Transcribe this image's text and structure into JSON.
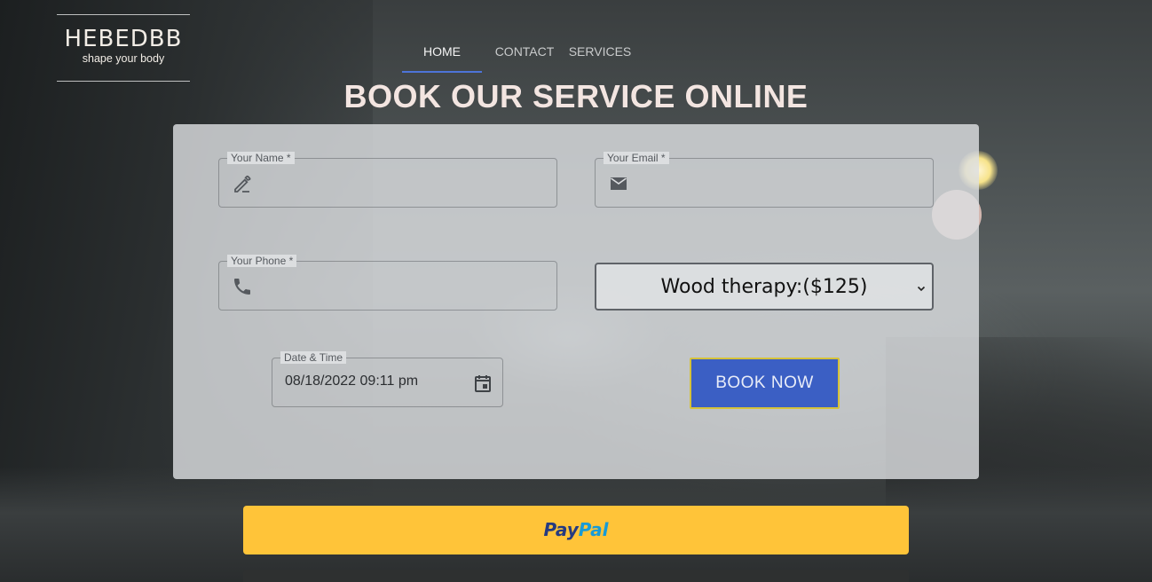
{
  "brand": {
    "name": "HEBEDBB",
    "tagline": "shape your body"
  },
  "nav": {
    "items": [
      {
        "label": "HOME",
        "active": true
      },
      {
        "label": "CONTACT",
        "active": false
      },
      {
        "label": "SERVICES",
        "active": false
      }
    ]
  },
  "page": {
    "title": "BOOK OUR SERVICE ONLINE"
  },
  "form": {
    "name": {
      "label": "Your Name *",
      "value": "",
      "icon": "pencil-icon"
    },
    "email": {
      "label": "Your Email *",
      "value": "",
      "icon": "mail-icon"
    },
    "phone": {
      "label": "Your Phone *",
      "value": "",
      "icon": "phone-icon"
    },
    "service": {
      "selected": "Wood therapy:($125)"
    },
    "datetime": {
      "label": "Date & Time",
      "value": "08/18/2022 09:11 pm",
      "icon": "calendar-icon"
    },
    "submit_label": "BOOK NOW"
  },
  "paypal": {
    "part1": "Pay",
    "part2": "Pal"
  },
  "colors": {
    "accent": "#3b5fc4",
    "button_border": "#d5c23a",
    "paypal_yellow": "#ffc439",
    "paypal_dark": "#253b80",
    "paypal_light": "#179bd7",
    "nav_underline": "#4d74d8"
  }
}
